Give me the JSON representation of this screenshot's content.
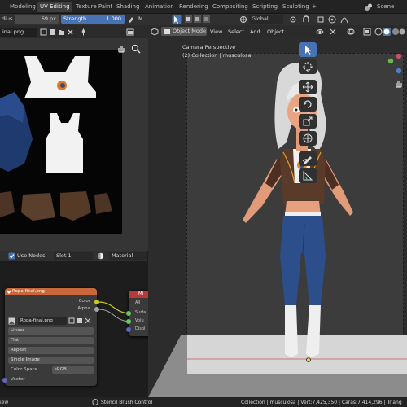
{
  "topbar": {
    "tabs": [
      "Modeling",
      "UV Editing",
      "Texture Paint",
      "Shading",
      "Animation",
      "Rendering",
      "Compositing",
      "Scripting",
      "Sculpting",
      "+"
    ],
    "active_tab": "UV Editing",
    "scene_label": "Scene"
  },
  "image_editor": {
    "radius_label": "dius",
    "radius_value": "69 px",
    "strength_label": "Strength",
    "strength_value": "1.000",
    "m_label": "M",
    "image_name": "inal.png"
  },
  "viewport": {
    "mode": "Object Mode",
    "menus": [
      "View",
      "Select",
      "Add",
      "Object"
    ],
    "transform_orientation": "Global",
    "overlay_title": "Camera Perspective",
    "overlay_collection": "(2) Collection | musculosa"
  },
  "node_editor": {
    "use_nodes_label": "Use Nodes",
    "slot_label": "Slot 1",
    "material_label": "Material",
    "view_label": "iew",
    "image_node": {
      "title": "Ropa-final.png",
      "out_color": "Color",
      "out_alpha": "Alpha",
      "image_field": "Ropa-final.png",
      "interpolation": "Linear",
      "projection": "Flat",
      "extension": "Repeat",
      "source": "Single Image",
      "color_space_label": "Color Space",
      "color_space_value": "sRGB",
      "vector_label": "Vector"
    },
    "bsdf_node": {
      "title": "Mi",
      "rows": [
        "All",
        "Surfa",
        "Volu",
        "Displ"
      ]
    }
  },
  "statusbar": {
    "left_label": "Stencil Brush Control",
    "right_text": "Collection | musculosa | Vert:7,425,350 | Caras:7,414,296 | Triang"
  },
  "colors": {
    "accent": "#4772b3",
    "image_node_header": "#c9663a",
    "bsdf_node_header": "#b73b3b",
    "socket_color": "#c7c729",
    "socket_shader": "#63c763",
    "socket_vector": "#6363c7"
  }
}
